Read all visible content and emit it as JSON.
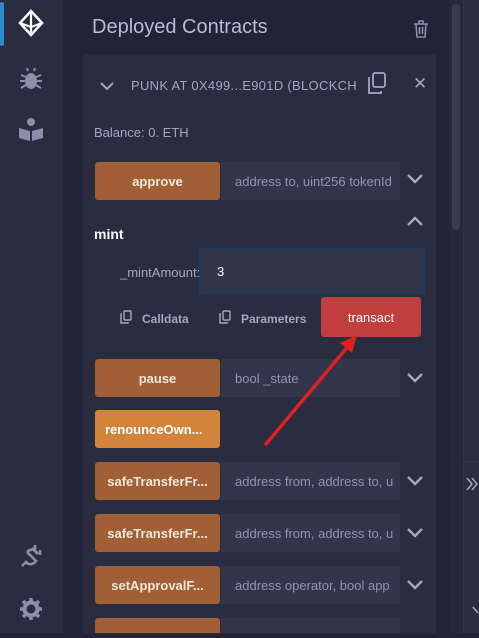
{
  "panel": {
    "title": "Deployed Contracts"
  },
  "contract": {
    "name": "PUNK AT 0X499...E901D (BLOCKCH",
    "balance": "Balance: 0. ETH"
  },
  "functions": [
    {
      "label": "approve",
      "placeholder": "address to, uint256 tokenId"
    },
    {
      "label": "pause",
      "placeholder": "bool _state"
    },
    {
      "label": "renounceOwn...",
      "placeholder": ""
    },
    {
      "label": "safeTransferFr...",
      "placeholder": "address from, address to, u"
    },
    {
      "label": "safeTransferFr...",
      "placeholder": "address from, address to, u"
    },
    {
      "label": "setApprovalF...",
      "placeholder": "address operator, bool app"
    }
  ],
  "mint": {
    "title": "mint",
    "param_label": "_mintAmount:",
    "value": "3",
    "calldata_label": "Calldata",
    "parameters_label": "Parameters",
    "transact_label": "transact"
  },
  "colors": {
    "accent": "#2b8bd3",
    "function_button": "#a05f34",
    "payable_button": "#d2843a",
    "transact_button": "#c23f3f",
    "annotation_arrow": "#e02020"
  }
}
